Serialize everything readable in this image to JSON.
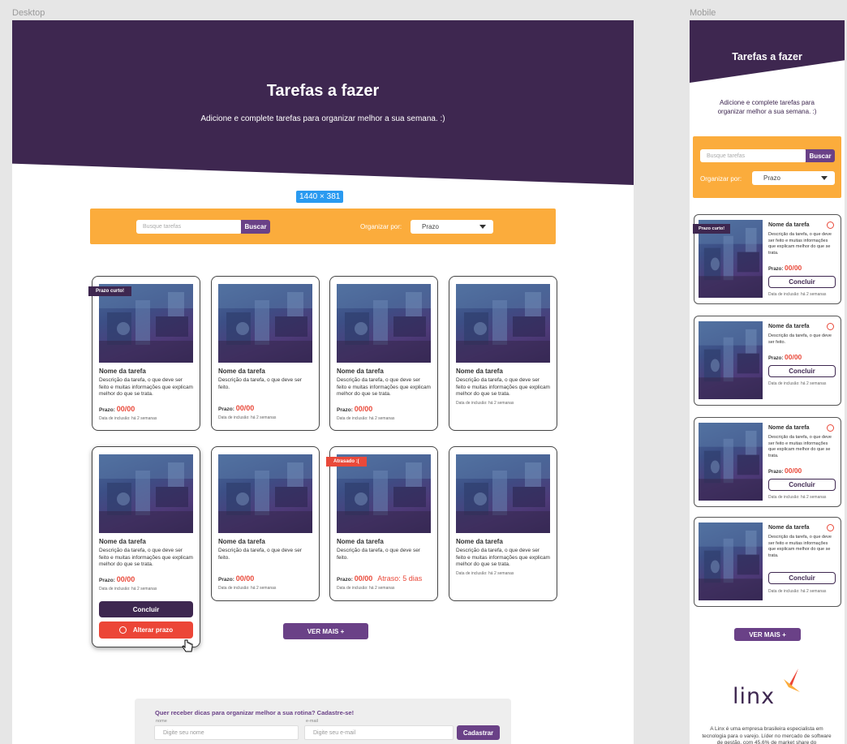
{
  "labels": {
    "desktop": "Desktop",
    "mobile": "Mobile",
    "frame_size": "1440 × 381"
  },
  "hero": {
    "title": "Tarefas a fazer",
    "subtitle": "Adicione e complete tarefas para organizar melhor a sua semana. :)"
  },
  "search": {
    "placeholder": "Busque tarefas",
    "button": "Buscar"
  },
  "sort": {
    "label": "Organizar por:",
    "value": "Prazo"
  },
  "card_defaults": {
    "name": "Nome da tarefa",
    "prazo_label": "Prazo:",
    "prazo_value": "00/00",
    "date": "Data de inclusão: há 2 semanas"
  },
  "cards": [
    {
      "desc": "Descrição da tarefa, o que deve ser feito e muitas informações que explicam melhor do que se trata.",
      "tag": "Prazo curto!"
    },
    {
      "desc": "Descrição da tarefa, o que deve ser feito."
    },
    {
      "desc": "Descrição da tarefa, o que deve ser feito e muitas informações que explicam melhor do que se trata."
    },
    {
      "desc": "Descrição da tarefa, o que deve ser feito e muitas informações que explicam melhor do que se trata."
    },
    {
      "desc": "Descrição da tarefa, o que deve ser feito e muitas informações que explicam melhor do que se trata."
    },
    {
      "desc": "Descrição da tarefa, o que deve ser feito."
    },
    {
      "desc": "Descrição da tarefa, o que deve ser feito.",
      "tag": "Atrasado :(",
      "late": "Atraso: 5 dias"
    },
    {
      "desc": "Descrição da tarefa, o que deve ser feito e muitas informações que explicam melhor do que se trata."
    }
  ],
  "actions": {
    "concluir": "Concluir",
    "alterar": "Alterar prazo",
    "ver_mais": "VER MAIS +"
  },
  "newsletter": {
    "title": "Quer receber dicas para organizar melhor a sua rotina? Cadastre-se!",
    "name_label": "nome",
    "name_placeholder": "Digite seu nome",
    "email_label": "e-mail",
    "email_placeholder": "Digite seu e-mail",
    "button": "Cadastrar"
  },
  "mobile_cards": [
    {
      "desc": "Descrição da tarefa, o que deve ser feito e muitas informações que explicam melhor do que se trata.",
      "tag": "Prazo curto!"
    },
    {
      "desc": "Descrição da tarefa, o que deve ser feito."
    },
    {
      "desc": "Descrição da tarefa, o que deve ser feito e muitas informações que explicam melhor do que se trata."
    },
    {
      "desc": "Descrição da tarefa, o que deve ser feito e muitas informações que explicam melhor do que se trata."
    }
  ],
  "brand": {
    "name": "linx",
    "description": "A Linx é uma empresa brasileira especialista em tecnologia para o varejo. Líder no mercado de software de gestão, com 45,6% de market share do"
  },
  "colors": {
    "primary": "#3e2750",
    "accent": "#6a4187",
    "orange": "#fbac3c",
    "red": "#e9493a"
  }
}
